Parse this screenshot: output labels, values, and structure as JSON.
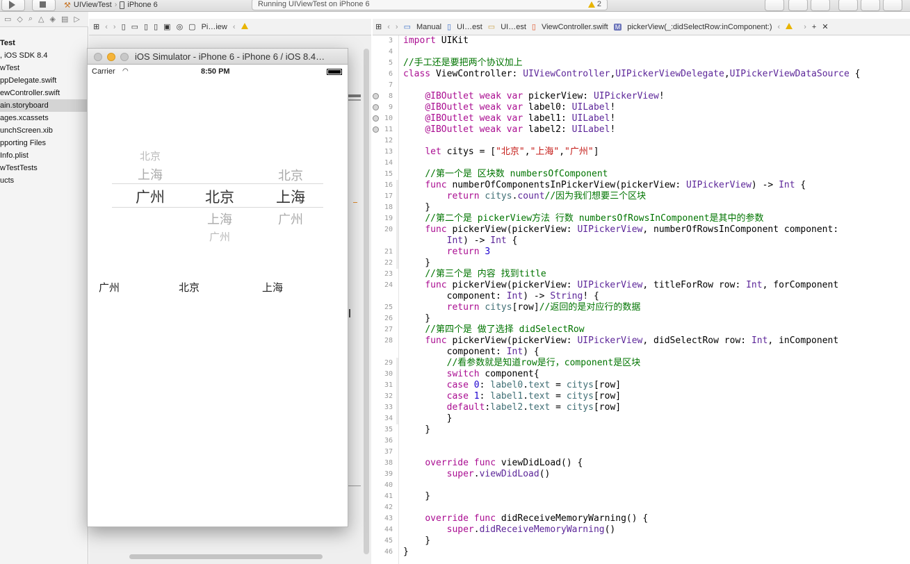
{
  "toolbar": {
    "scheme_project": "UIViewTest",
    "scheme_device": "iPhone 6",
    "status": "Running UIViewTest on iPhone 6",
    "warning_count": "2"
  },
  "navigator": {
    "items": [
      {
        "label": "Test",
        "bold": true,
        "selected": false
      },
      {
        "label": ", iOS SDK 8.4",
        "bold": false,
        "selected": false
      },
      {
        "label": "wTest",
        "bold": false,
        "selected": false
      },
      {
        "label": "ppDelegate.swift",
        "bold": false,
        "selected": false
      },
      {
        "label": "ewController.swift",
        "bold": false,
        "selected": false
      },
      {
        "label": "ain.storyboard",
        "bold": false,
        "selected": true
      },
      {
        "label": "ages.xcassets",
        "bold": false,
        "selected": false
      },
      {
        "label": "unchScreen.xib",
        "bold": false,
        "selected": false
      },
      {
        "label": "pporting Files",
        "bold": false,
        "selected": false
      },
      {
        "label": "Info.plist",
        "bold": false,
        "selected": false
      },
      {
        "label": "wTestTests",
        "bold": false,
        "selected": false
      },
      {
        "label": "ucts",
        "bold": false,
        "selected": false
      }
    ]
  },
  "left_jumpbar": {
    "item": "Pi…iew"
  },
  "right_jumpbar": {
    "items": [
      "Manual",
      "UI…est",
      "UI…est",
      "ViewController.swift",
      "pickerView(_:didSelectRow:inComponent:)"
    ]
  },
  "simulator": {
    "title": "iOS Simulator - iPhone 6 - iPhone 6 / iOS 8.4…",
    "carrier": "Carrier",
    "time": "8:50 PM",
    "picker": {
      "col0": {
        "n2": "北京",
        "n1": "上海",
        "sel": "广州"
      },
      "col1": {
        "sel": "北京",
        "n1": "上海",
        "n2": "广州"
      },
      "col2": {
        "n1_up": "北京",
        "sel": "上海",
        "n1": "广州"
      }
    },
    "labels": [
      "广州",
      "北京",
      "上海"
    ]
  },
  "editor": {
    "line_numbers": [
      "3",
      "4",
      "5",
      "6",
      "7",
      "8",
      "9",
      "10",
      "11",
      "12",
      "13",
      "14",
      "15",
      "16",
      "17",
      "18",
      "19",
      "20",
      "",
      "21",
      "22",
      "23",
      "24",
      "",
      "25",
      "26",
      "27",
      "28",
      "",
      "29",
      "30",
      "31",
      "32",
      "33",
      "34",
      "35",
      "36",
      "37",
      "38",
      "39",
      "40",
      "41",
      "42",
      "43",
      "44",
      "45",
      "46"
    ],
    "outlet_lines": [
      "8",
      "9",
      "10",
      "11"
    ]
  }
}
